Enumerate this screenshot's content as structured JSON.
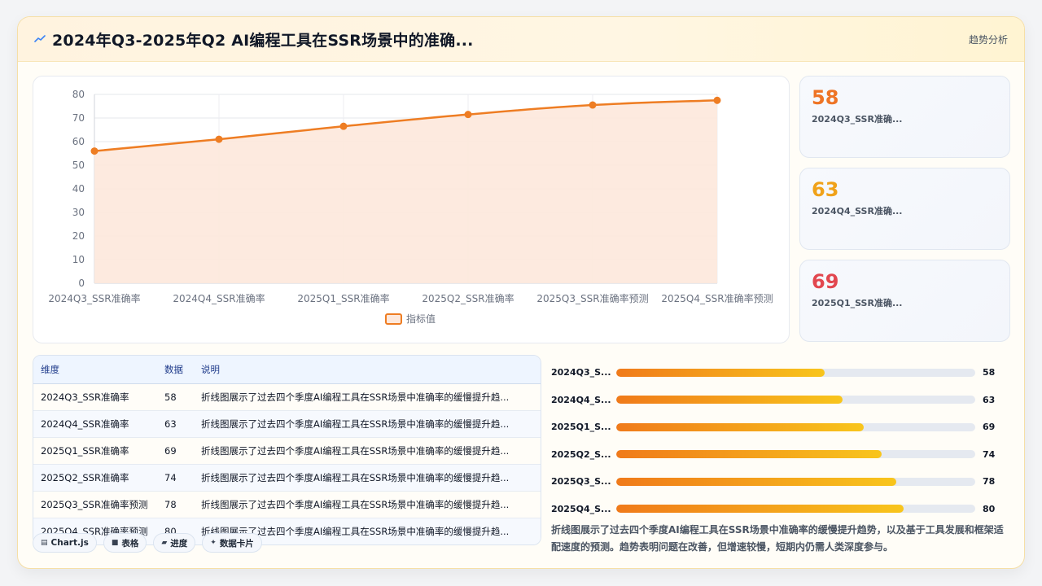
{
  "header": {
    "title": "2024年Q3-2025年Q2 AI编程工具在SSR场景中的准确...",
    "badge": "趋势分析"
  },
  "colors": {
    "line": "#ee7d23",
    "area": "#fde8dc",
    "stat1": "#ee7425",
    "stat2": "#f0a21a",
    "stat3": "#e2474f"
  },
  "chart_data": {
    "type": "line",
    "categories": [
      "2024Q3_SSR准确率",
      "2024Q4_SSR准确率",
      "2025Q1_SSR准确率",
      "2025Q2_SSR准确率",
      "2025Q3_SSR准确率预测",
      "2025Q4_SSR准确率预测"
    ],
    "series": [
      {
        "name": "指标值",
        "values": [
          56,
          61,
          66.5,
          71.5,
          75.5,
          77.5
        ]
      }
    ],
    "yticks": [
      0,
      10,
      20,
      30,
      40,
      50,
      60,
      70,
      80
    ],
    "ylim": [
      0,
      80
    ],
    "grid": true,
    "legend": "bottom",
    "fill": true
  },
  "stats": [
    {
      "value": "58",
      "label": "2024Q3_SSR准确..."
    },
    {
      "value": "63",
      "label": "2024Q4_SSR准确..."
    },
    {
      "value": "69",
      "label": "2025Q1_SSR准确..."
    }
  ],
  "table": {
    "headers": [
      "维度",
      "数据",
      "说明"
    ],
    "rows": [
      [
        "2024Q3_SSR准确率",
        "58",
        "折线图展示了过去四个季度AI编程工具在SSR场景中准确率的缓慢提升趋..."
      ],
      [
        "2024Q4_SSR准确率",
        "63",
        "折线图展示了过去四个季度AI编程工具在SSR场景中准确率的缓慢提升趋..."
      ],
      [
        "2025Q1_SSR准确率",
        "69",
        "折线图展示了过去四个季度AI编程工具在SSR场景中准确率的缓慢提升趋..."
      ],
      [
        "2025Q2_SSR准确率",
        "74",
        "折线图展示了过去四个季度AI编程工具在SSR场景中准确率的缓慢提升趋..."
      ],
      [
        "2025Q3_SSR准确率预测",
        "78",
        "折线图展示了过去四个季度AI编程工具在SSR场景中准确率的缓慢提升趋..."
      ],
      [
        "2025Q4_SSR准确率预测",
        "80",
        "折线图展示了过去四个季度AI编程工具在SSR场景中准确率的缓慢提升趋..."
      ]
    ]
  },
  "tags": [
    {
      "icon": "chart-icon",
      "label": "Chart.js"
    },
    {
      "icon": "table-icon",
      "label": "表格"
    },
    {
      "icon": "progress-icon",
      "label": "进度"
    },
    {
      "icon": "sparkle-icon",
      "label": "数据卡片"
    }
  ],
  "bars": {
    "max": 100,
    "items": [
      {
        "label": "2024Q3_S...",
        "value": 58
      },
      {
        "label": "2024Q4_S...",
        "value": 63
      },
      {
        "label": "2025Q1_S...",
        "value": 69
      },
      {
        "label": "2025Q2_S...",
        "value": 74
      },
      {
        "label": "2025Q3_S...",
        "value": 78
      },
      {
        "label": "2025Q4_S...",
        "value": 80
      }
    ]
  },
  "summary": "折线图展示了过去四个季度AI编程工具在SSR场景中准确率的缓慢提升趋势，以及基于工具发展和框架适配速度的预测。趋势表明问题在改善，但增速较慢，短期内仍需人类深度参与。"
}
